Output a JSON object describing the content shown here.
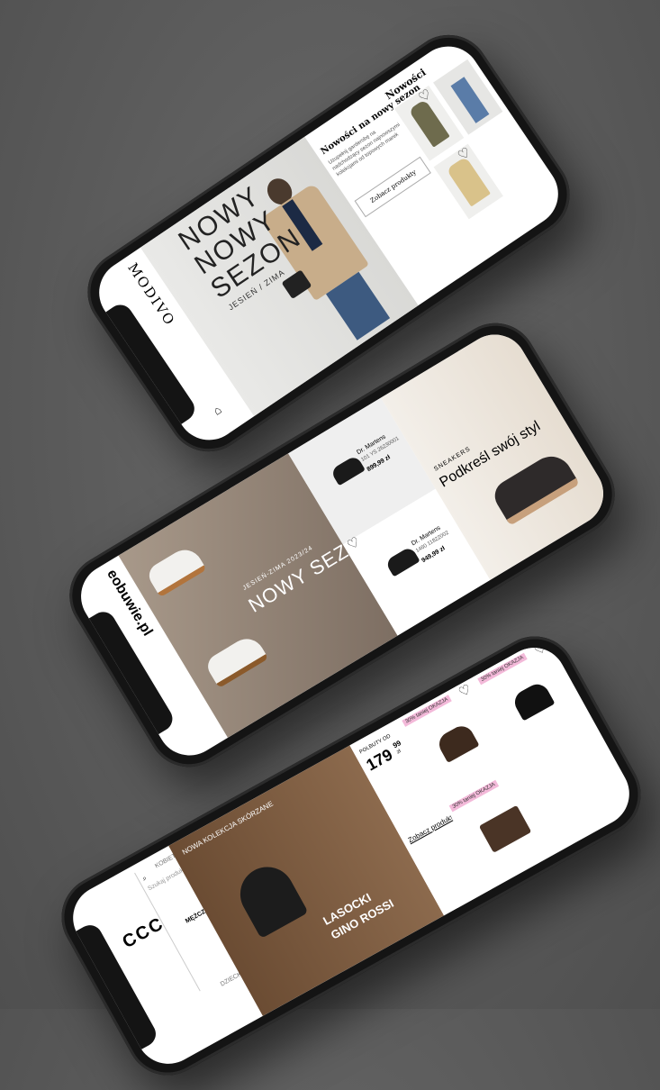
{
  "modivo": {
    "logo": "MODIVO",
    "hero_line1": "NOWY",
    "hero_line2": "NOWY",
    "hero_line3": "SEZON",
    "hero_sub": "JESIEŃ / ZIMA",
    "promo_title": "Nowości na nowy sezon",
    "promo_text": "Uzupełnij garderobę na nadchodzący sezon najnowszymi kolekcjami od topowych marek",
    "cta": "Zobacz produkty",
    "section_title": "Nowości"
  },
  "eobuwie": {
    "logo": "eobuwie.pl",
    "season": "JESIEŃ-ZIMA 2023/24",
    "headline": "NOWY SEZON",
    "product1": {
      "brand": "Dr. Martens",
      "model": "101 YS 26230001",
      "price": "899,99 zł"
    },
    "product2": {
      "brand": "Dr. Martens",
      "model": "1460 11822002",
      "price": "949,99 zł"
    },
    "category": "SNEAKERS",
    "slogan": "Podkreśl swój styl"
  },
  "ccc": {
    "logo": "CCC",
    "search_placeholder": "Szukaj produktów",
    "tabs": [
      "KOBIETA",
      "MĘŻCZYZNA",
      "DZIECKO"
    ],
    "banner_brand1": "LASOCKI",
    "banner_brand2": "GINO ROSSI",
    "banner_headline": "NOWA KOLEKCJA SKÓRZANE",
    "price_label": "POLBUTY OD",
    "price_main": "179",
    "price_cents": "99",
    "price_currency": "zł",
    "cta": "Zobacz produkty",
    "badge": "30% taniej OKAZJA"
  },
  "colors": {
    "background": "#5b5b5b",
    "phone": "#141414",
    "ccc_badge": "#f3b9d9",
    "eobuwie_hero": "#8a7a6a",
    "modivo_coat": "#c8ad8a"
  }
}
